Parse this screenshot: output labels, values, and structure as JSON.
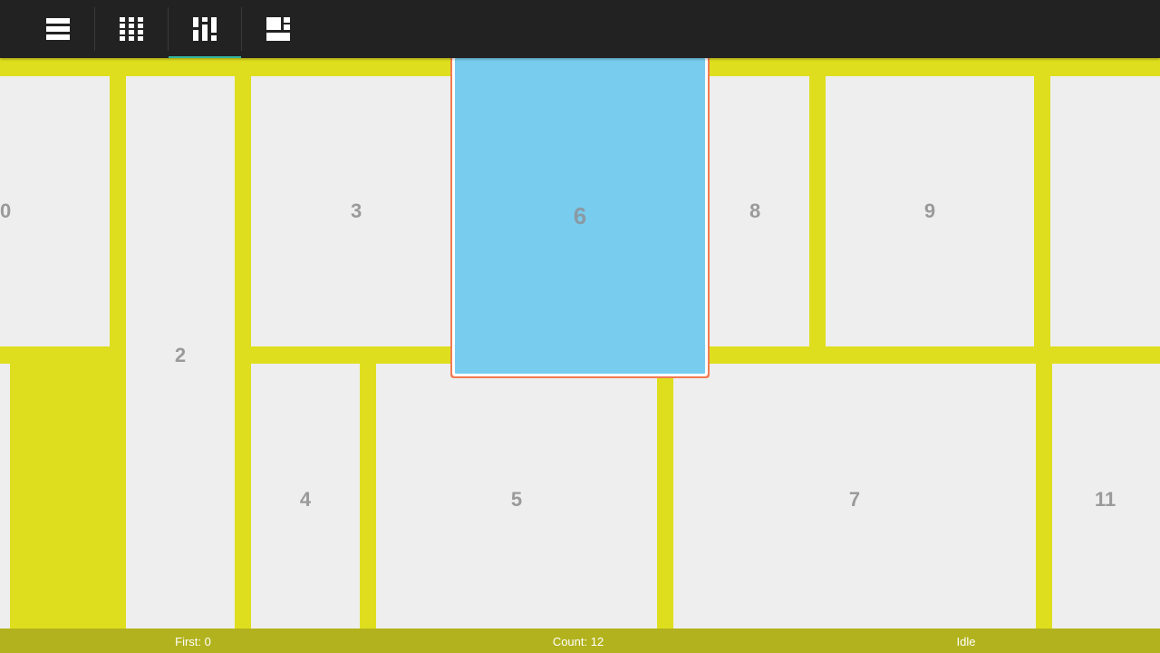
{
  "toolbar": {
    "tabs": [
      {
        "name": "list-layout-tab",
        "icon": "list-icon",
        "selected": false
      },
      {
        "name": "grid-layout-tab",
        "icon": "grid-icon",
        "selected": false
      },
      {
        "name": "staggered-grid-layout-tab",
        "icon": "staggered-grid-icon",
        "selected": true
      },
      {
        "name": "spannable-grid-layout-tab",
        "icon": "spannable-grid-icon",
        "selected": false
      }
    ],
    "accent_color": "#33b5a0"
  },
  "grid": {
    "background_color": "#dede1e",
    "item_color": "#eeeeee",
    "selected_item_color": "#78cdef",
    "selection_outline_color": "#f27b52",
    "items": [
      {
        "label": "0"
      },
      {
        "label": "2"
      },
      {
        "label": "3"
      },
      {
        "label": "4"
      },
      {
        "label": "5"
      },
      {
        "label": "6",
        "selected": true
      },
      {
        "label": "7"
      },
      {
        "label": "8"
      },
      {
        "label": "9"
      },
      {
        "label": "11"
      }
    ]
  },
  "status": {
    "first": "First: 0",
    "count": "Count: 12",
    "state": "Idle"
  }
}
